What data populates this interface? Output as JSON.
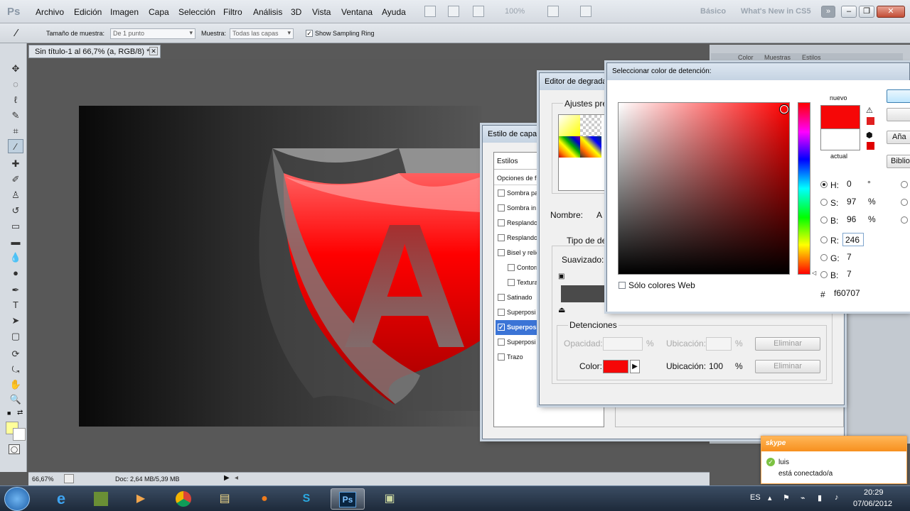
{
  "app": {
    "logo": "Ps"
  },
  "menu": [
    "Archivo",
    "Edición",
    "Imagen",
    "Capa",
    "Selección",
    "Filtro",
    "Análisis",
    "3D",
    "Vista",
    "Ventana",
    "Ayuda"
  ],
  "menubar": {
    "zoom": "100%",
    "workspace_basic": "Básico",
    "workspace_whats_new": "What's New in CS5",
    "overflow": "»"
  },
  "options": {
    "sample_size_label": "Tamaño de muestra:",
    "sample_size_value": "De 1 punto",
    "sample_label": "Muestra:",
    "sample_value": "Todas las capas",
    "show_ring_label": "Show Sampling Ring",
    "show_ring_checked": true
  },
  "document": {
    "tab_title": "Sin título-1 al 66,7% (a, RGB/8) *",
    "canvas_letter": "A",
    "status_zoom": "66,67%",
    "status_doc": "Doc: 2,64 MB/5,39 MB"
  },
  "panels": {
    "tabs": [
      "Color",
      "Muestras",
      "Estilos"
    ]
  },
  "layer_style": {
    "title": "Estilo de capa",
    "styles_header": "Estilos",
    "blend_options": "Opciones de f",
    "items": [
      {
        "label": "Sombra pa",
        "checked": false
      },
      {
        "label": "Sombra in",
        "checked": false
      },
      {
        "label": "Resplando",
        "checked": false
      },
      {
        "label": "Resplando",
        "checked": false
      },
      {
        "label": "Bisel y relie",
        "checked": false
      },
      {
        "label": "Contorr",
        "checked": false,
        "sub": true
      },
      {
        "label": "Textura",
        "checked": false,
        "sub": true
      },
      {
        "label": "Satinado",
        "checked": false
      },
      {
        "label": "Superposi",
        "checked": false
      },
      {
        "label": "Superpos",
        "checked": true,
        "selected": true
      },
      {
        "label": "Superposi",
        "checked": false
      },
      {
        "label": "Trazo",
        "checked": false
      }
    ]
  },
  "gradient_editor": {
    "title": "Editor de degrada",
    "presets_label": "Ajustes pre",
    "name_label": "Nombre:",
    "name_value": "A",
    "type_label": "Tipo de de",
    "smoothness_label": "Suavizado:",
    "stops_label": "Detenciones",
    "opacity_label": "Opacidad:",
    "location_label": "Ubicación:",
    "percent": "%",
    "delete_label": "Eliminar",
    "color_label": "Color:",
    "color_value": "#f60707",
    "color_location": "100"
  },
  "color_picker": {
    "title": "Seleccionar color de detención:",
    "new_label": "nuevo",
    "current_label": "actual",
    "new_color": "#f60707",
    "current_color": "#ffffff",
    "h_label": "H:",
    "h_value": "0",
    "h_unit": "°",
    "s_label": "S:",
    "s_value": "97",
    "s_unit": "%",
    "b_label": "B:",
    "b_value": "96",
    "b_unit": "%",
    "r_label": "R:",
    "r_value": "246",
    "g_label": "G:",
    "g_value": "7",
    "bb_label": "B:",
    "bb_value": "7",
    "hex_label": "#",
    "hex_value": "f60707",
    "web_only_label": "Sólo colores Web",
    "add_button": "Aña",
    "libraries_button": "Biblio"
  },
  "skype": {
    "brand": "skype",
    "user": "luis",
    "status": "está conectado/a"
  },
  "taskbar": {
    "lang": "ES",
    "time": "20:29",
    "date": "07/06/2012",
    "ps_label": "Ps"
  }
}
